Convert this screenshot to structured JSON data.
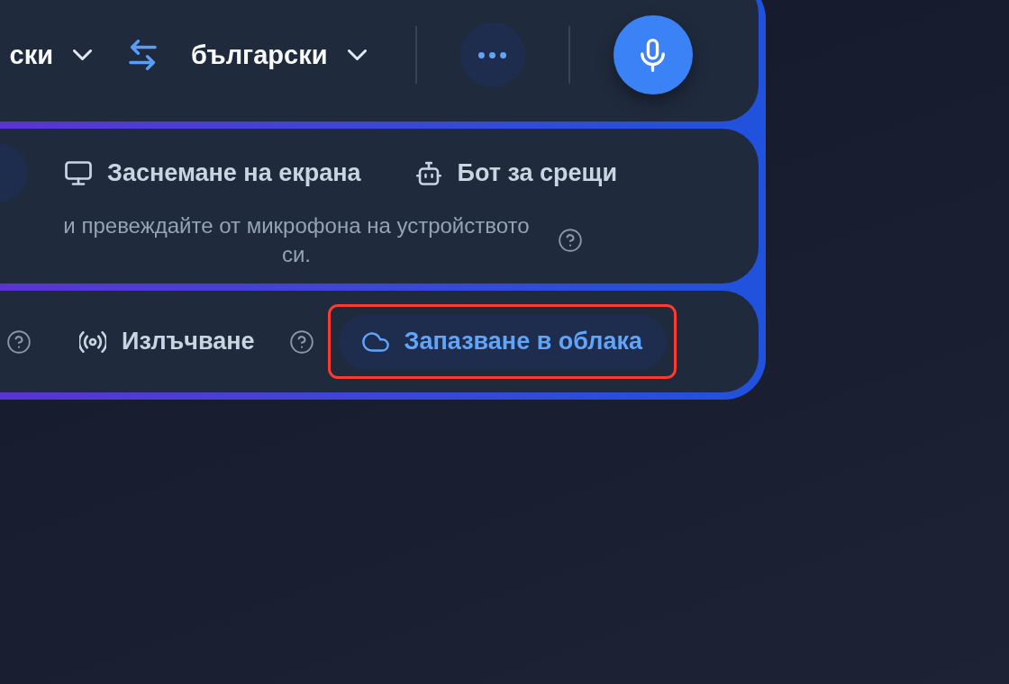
{
  "language_bar": {
    "source_language": "ски",
    "target_language": "български"
  },
  "input_modes": [
    {
      "selected": true
    },
    {
      "kind": "screen",
      "label": "Заснемане на екрана",
      "selected": false
    },
    {
      "kind": "bot",
      "label": "Бот за срещи",
      "selected": false
    }
  ],
  "mode_description": "и превеждайте от микрофона на устройството си.",
  "output_options": [
    {
      "help": true
    },
    {
      "kind": "broadcast",
      "label": "Излъчване",
      "selected": false,
      "help": true,
      "highlighted": false
    },
    {
      "kind": "cloud",
      "label": "Запазване в облака",
      "selected": true,
      "help": false,
      "highlighted": true
    }
  ]
}
